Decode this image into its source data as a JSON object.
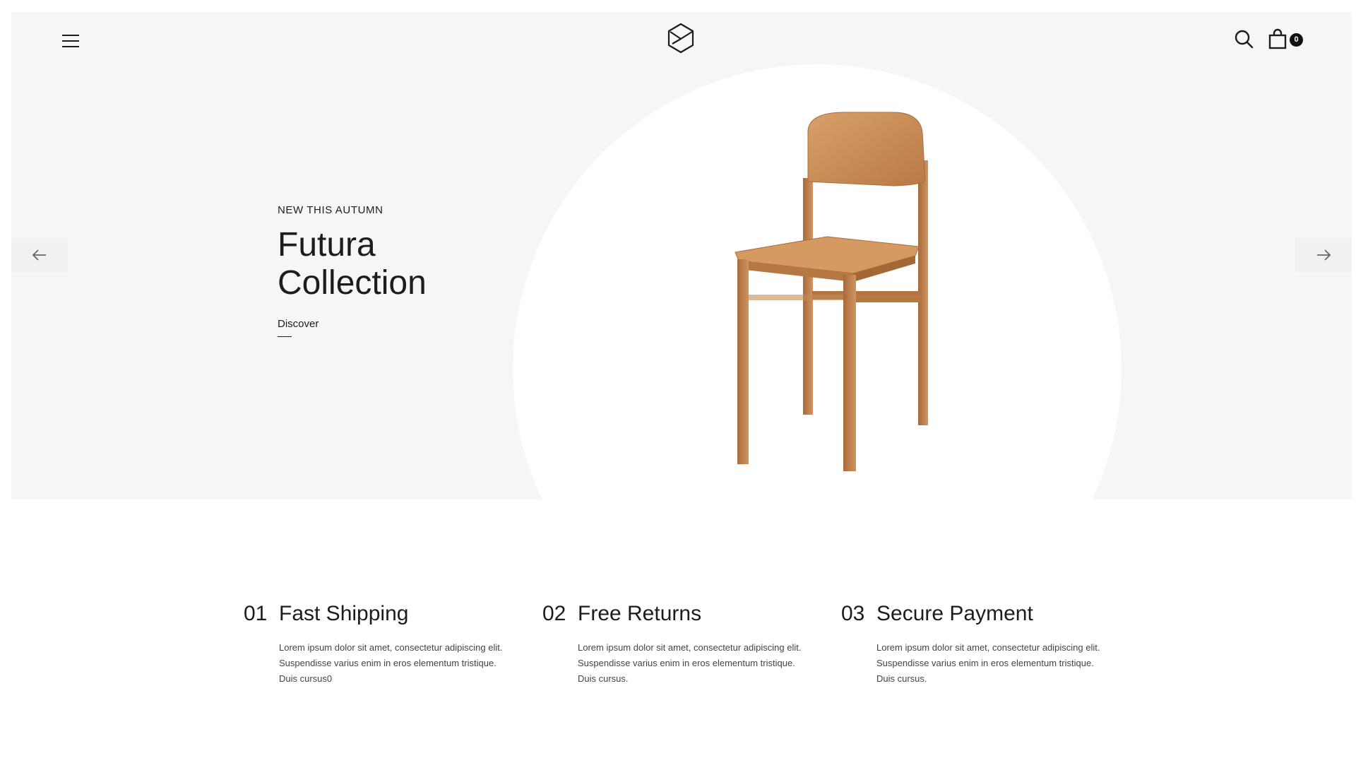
{
  "header": {
    "menu_icon": "hamburger-menu-icon",
    "logo_icon": "hexagon-cube-logo",
    "search_icon": "search-icon",
    "cart_icon": "shopping-bag-icon",
    "cart_count": "0"
  },
  "hero": {
    "eyebrow": "NEW THIS AUTUMN",
    "title": "Futura Collection",
    "cta": "Discover",
    "prev_icon": "arrow-left-icon",
    "next_icon": "arrow-right-icon",
    "image": "wooden-chair"
  },
  "features": [
    {
      "number": "01",
      "title": "Fast Shipping",
      "description": "Lorem ipsum dolor sit amet, consectetur adipiscing elit. Suspendisse varius enim in eros elementum tristique. Duis cursus0"
    },
    {
      "number": "02",
      "title": "Free Returns",
      "description": "Lorem ipsum dolor sit amet, consectetur adipiscing elit. Suspendisse varius enim in eros elementum tristique. Duis cursus."
    },
    {
      "number": "03",
      "title": "Secure Payment",
      "description": "Lorem ipsum dolor sit amet, consectetur adipiscing elit. Suspendisse varius enim in eros elementum tristique. Duis cursus."
    }
  ],
  "colors": {
    "hero_bg": "#f7f6f4",
    "circle": "#ffffff",
    "text": "#1c1c1c",
    "wood": "#c98b55"
  }
}
